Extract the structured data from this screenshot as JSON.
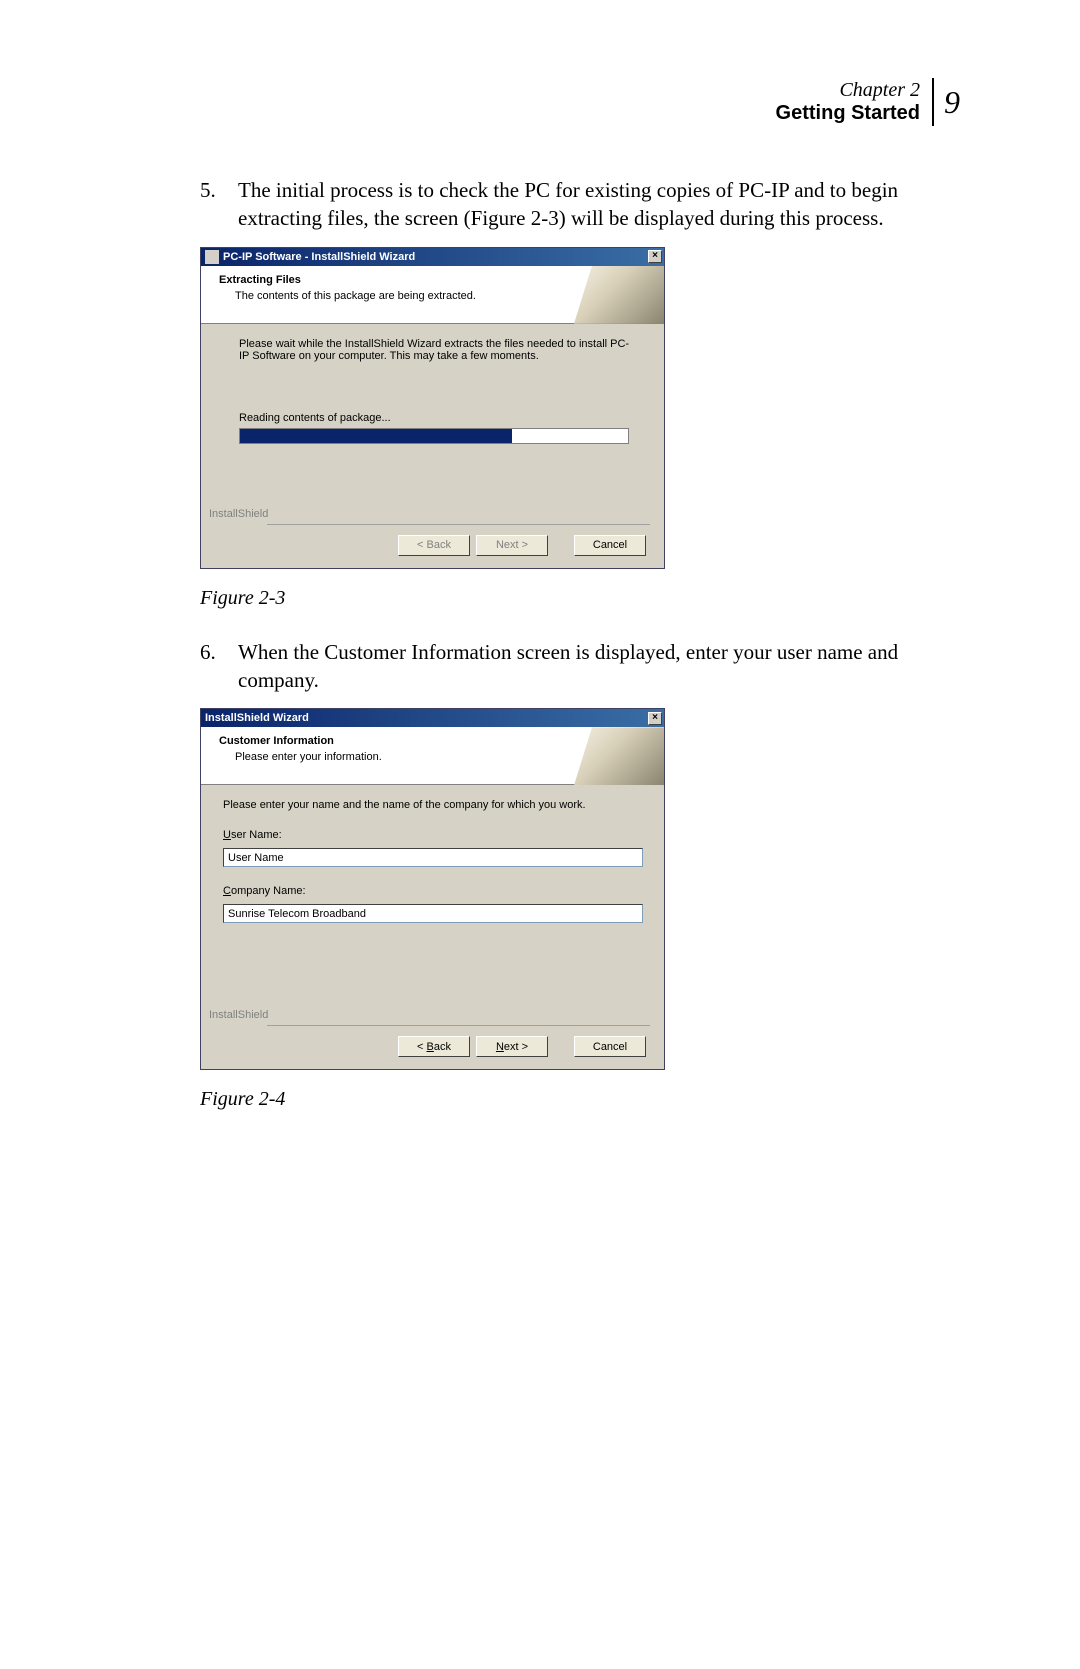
{
  "header": {
    "chapter": "Chapter 2",
    "section": "Getting Started",
    "page_number": "9"
  },
  "step5": {
    "num": "5.",
    "text": "The initial process is to check the PC for existing copies of PC-IP and to begin extracting files, the screen (Figure 2-3) will be displayed during this process."
  },
  "fig23": {
    "title": "PC-IP Software - InstallShield Wizard",
    "header_title": "Extracting Files",
    "header_sub": "The contents of this package are being extracted.",
    "body_text": "Please wait while the InstallShield Wizard extracts the files needed to install PC-IP Software on your computer.  This may take a few moments.",
    "progress_label": "Reading contents of package...",
    "footer_label": "InstallShield",
    "back": "< Back",
    "next": "Next >",
    "cancel": "Cancel",
    "caption": "Figure 2-3"
  },
  "step6": {
    "num": "6.",
    "text": "When the Customer Information screen is displayed, enter your user name and company."
  },
  "fig24": {
    "title": "InstallShield Wizard",
    "header_title": "Customer Information",
    "header_sub": "Please enter your information.",
    "body_text": "Please enter your name and the name of the company for which you work.",
    "user_label_u": "U",
    "user_label_rest": "ser Name:",
    "user_value": "User Name",
    "company_label_u": "C",
    "company_label_rest": "ompany Name:",
    "company_value": "Sunrise Telecom Broadband",
    "footer_label": "InstallShield",
    "back_u": "B",
    "back_pre": "< ",
    "back_post": "ack",
    "next_u": "N",
    "next_post": "ext >",
    "cancel": "Cancel",
    "caption": "Figure 2-4"
  }
}
